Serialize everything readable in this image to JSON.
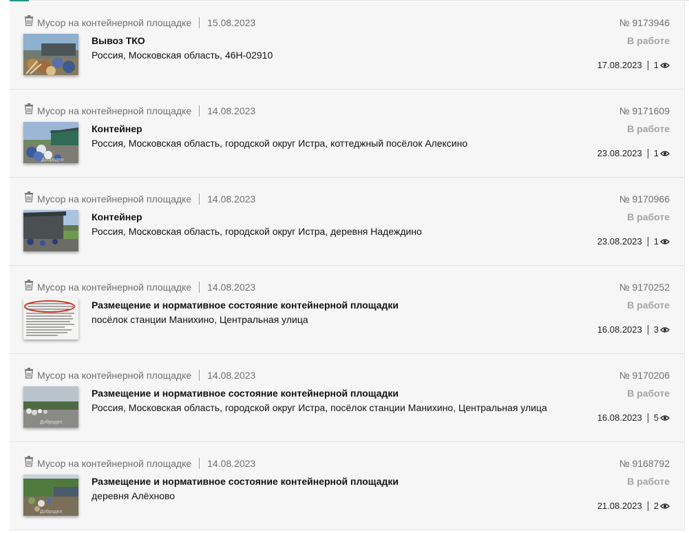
{
  "colors": {
    "accent": "#1a9a83",
    "status": "#a4a4a4"
  },
  "icons": {
    "category": "trash-bin-icon",
    "views": "eye-icon"
  },
  "cards": [
    {
      "category": "Мусор на контейнерной площадке",
      "date": "15.08.2023",
      "title": "Вывоз ТКО",
      "address": "Россия, Московская область, 46Н-02910",
      "number": "№ 9173946",
      "status": "В работе",
      "updated": "17.08.2023",
      "views": "1",
      "thumb_caption": ""
    },
    {
      "category": "Мусор на контейнерной площадке",
      "date": "14.08.2023",
      "title": "Контейнер",
      "address": "Россия, Московская область, городской округ Истра, коттеджный посёлок Алексино",
      "number": "№ 9171609",
      "status": "В работе",
      "updated": "23.08.2023",
      "views": "1",
      "thumb_caption": "Добродел"
    },
    {
      "category": "Мусор на контейнерной площадке",
      "date": "14.08.2023",
      "title": "Контейнер",
      "address": "Россия, Московская область, городской округ Истра, деревня Надеждино",
      "number": "№ 9170966",
      "status": "В работе",
      "updated": "23.08.2023",
      "views": "1",
      "thumb_caption": ""
    },
    {
      "category": "Мусор на контейнерной площадке",
      "date": "14.08.2023",
      "title": "Размещение и нормативное состояние контейнерной площадки",
      "address": "посёлок станции Манихино, Центральная улица",
      "number": "№ 9170252",
      "status": "В работе",
      "updated": "16.08.2023",
      "views": "3",
      "thumb_caption": ""
    },
    {
      "category": "Мусор на контейнерной площадке",
      "date": "14.08.2023",
      "title": "Размещение и нормативное состояние контейнерной площадки",
      "address": "Россия, Московская область, городской округ Истра, посёлок станции Манихино, Центральная улица",
      "number": "№ 9170206",
      "status": "В работе",
      "updated": "16.08.2023",
      "views": "5",
      "thumb_caption": "Добродел"
    },
    {
      "category": "Мусор на контейнерной площадке",
      "date": "14.08.2023",
      "title": "Размещение и нормативное состояние контейнерной площадки",
      "address": "деревня Алёхново",
      "number": "№ 9168792",
      "status": "В работе",
      "updated": "21.08.2023",
      "views": "2",
      "thumb_caption": "Добродел"
    }
  ]
}
